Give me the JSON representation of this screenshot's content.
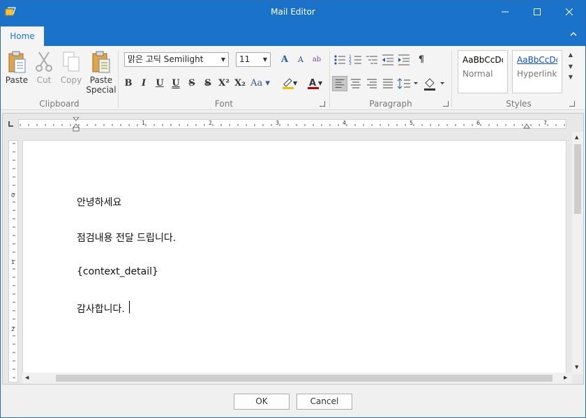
{
  "window": {
    "title": "Mail Editor",
    "controls": [
      "minimize-icon",
      "maximize-icon",
      "close-icon"
    ]
  },
  "ribbon": {
    "tabs": [
      {
        "label": "Home",
        "active": true
      }
    ],
    "groups": {
      "clipboard": {
        "label": "Clipboard",
        "paste": "Paste",
        "cut": "Cut",
        "copy": "Copy",
        "paste_special_1": "Paste",
        "paste_special_2": "Special"
      },
      "font": {
        "label": "Font",
        "font_name": "맑은 고딕 Semilight",
        "font_size": "11"
      },
      "paragraph": {
        "label": "Paragraph"
      },
      "styles": {
        "label": "Styles",
        "items": [
          {
            "preview": "AaBbCcDd",
            "name": "Normal"
          },
          {
            "preview": "AaBbCcDd",
            "name": "Hyperlink"
          }
        ]
      }
    }
  },
  "ruler": {
    "h_numbers": [
      "1",
      "2",
      "3",
      "4",
      "5",
      "6",
      "7"
    ],
    "v_numbers": [
      "0",
      "1",
      "2"
    ]
  },
  "document": {
    "paragraphs": [
      "안녕하세요",
      "점검내용 전달 드립니다.",
      "{context_detail}",
      "감사합니다."
    ]
  },
  "dialog": {
    "ok": "OK",
    "cancel": "Cancel"
  },
  "colors": {
    "accent": "#1a73c9",
    "highlight": "#f0c000",
    "font_color": "#c00000"
  }
}
